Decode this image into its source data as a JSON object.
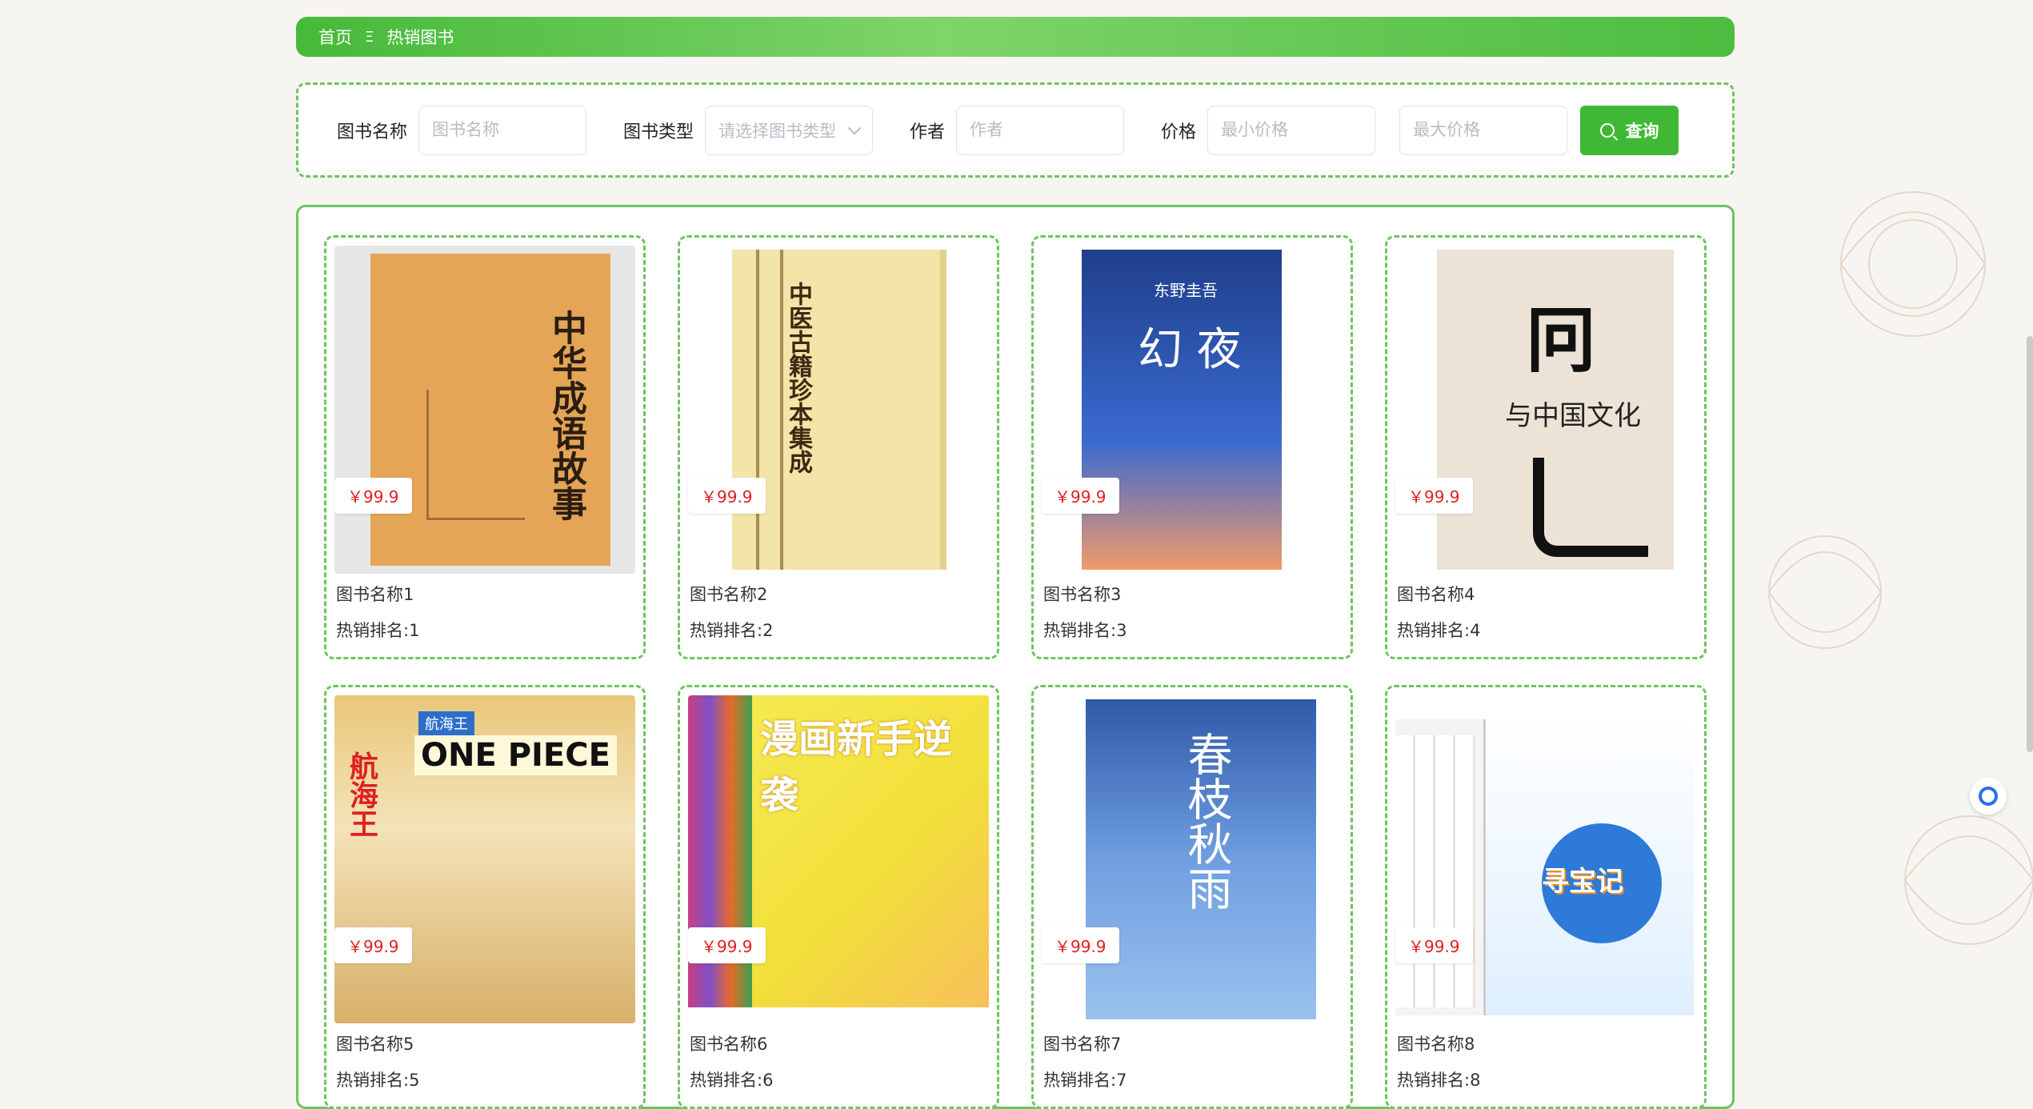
{
  "breadcrumb": {
    "home": "首页",
    "separator": "Ξ",
    "current": "热销图书"
  },
  "search": {
    "book_name_label": "图书名称",
    "book_name_placeholder": "图书名称",
    "book_type_label": "图书类型",
    "book_type_placeholder": "请选择图书类型",
    "author_label": "作者",
    "author_placeholder": "作者",
    "price_label": "价格",
    "min_price_placeholder": "最小价格",
    "max_price_placeholder": "最大价格",
    "query_label": "查询"
  },
  "books": [
    {
      "price": "￥99.9",
      "name": "图书名称1",
      "rank": "热销排名:1",
      "cover_title": "中华成语故事",
      "bg": "#e4a557"
    },
    {
      "price": "￥99.9",
      "name": "图书名称2",
      "rank": "热销排名:2",
      "cover_title": "中医古籍珍本集成",
      "bg": "#f3e4a8"
    },
    {
      "price": "￥99.9",
      "name": "图书名称3",
      "rank": "热销排名:3",
      "cover_title": "幻 夜",
      "cover_sub": "东野圭吾",
      "bg": "#1f3f8a"
    },
    {
      "price": "￥99.9",
      "name": "图书名称4",
      "rank": "热销排名:4",
      "cover_title": "与中国文化",
      "bg": "#ece3d6"
    },
    {
      "price": "￥99.9",
      "name": "图书名称5",
      "rank": "热销排名:5",
      "cover_title": "ONE PIECE",
      "cover_sub": "航海王",
      "bg": "#e9c77a"
    },
    {
      "price": "￥99.9",
      "name": "图书名称6",
      "rank": "热销排名:6",
      "cover_title": "漫画新手逆袭",
      "bg": "#f2df3a"
    },
    {
      "price": "￥99.9",
      "name": "图书名称7",
      "rank": "热销排名:7",
      "cover_title": "春枝秋雨",
      "bg": "#4e7fd0"
    },
    {
      "price": "￥99.9",
      "name": "图书名称8",
      "rank": "热销排名:8",
      "cover_title": "寻宝记",
      "bg": "#f4f4f4"
    }
  ],
  "colors": {
    "accent": "#3fb935",
    "price": "#e02020",
    "border": "#6cc45f"
  }
}
